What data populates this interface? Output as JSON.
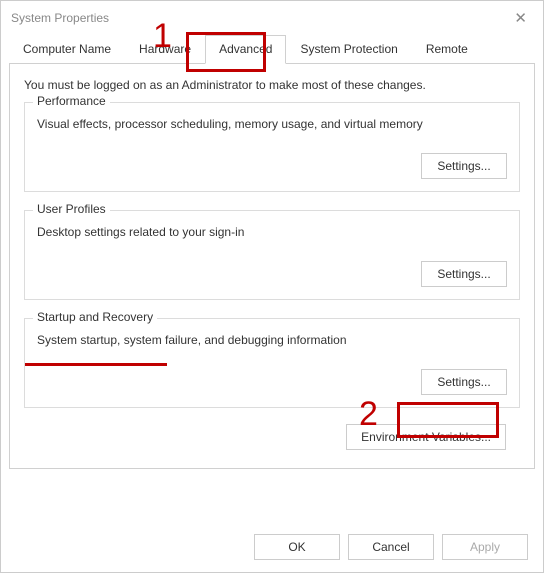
{
  "window": {
    "title": "System Properties"
  },
  "tabs": {
    "computer_name": "Computer Name",
    "hardware": "Hardware",
    "advanced": "Advanced",
    "system_protection": "System Protection",
    "remote": "Remote"
  },
  "intro": "You must be logged on as an Administrator to make most of these changes.",
  "performance": {
    "title": "Performance",
    "desc": "Visual effects, processor scheduling, memory usage, and virtual memory",
    "button": "Settings..."
  },
  "user_profiles": {
    "title": "User Profiles",
    "desc": "Desktop settings related to your sign-in",
    "button": "Settings..."
  },
  "startup_recovery": {
    "title": "Startup and Recovery",
    "desc": "System startup, system failure, and debugging information",
    "button": "Settings..."
  },
  "env_button": "Environment Variables...",
  "dialog_buttons": {
    "ok": "OK",
    "cancel": "Cancel",
    "apply": "Apply"
  },
  "annotations": {
    "one": "1",
    "two": "2"
  }
}
